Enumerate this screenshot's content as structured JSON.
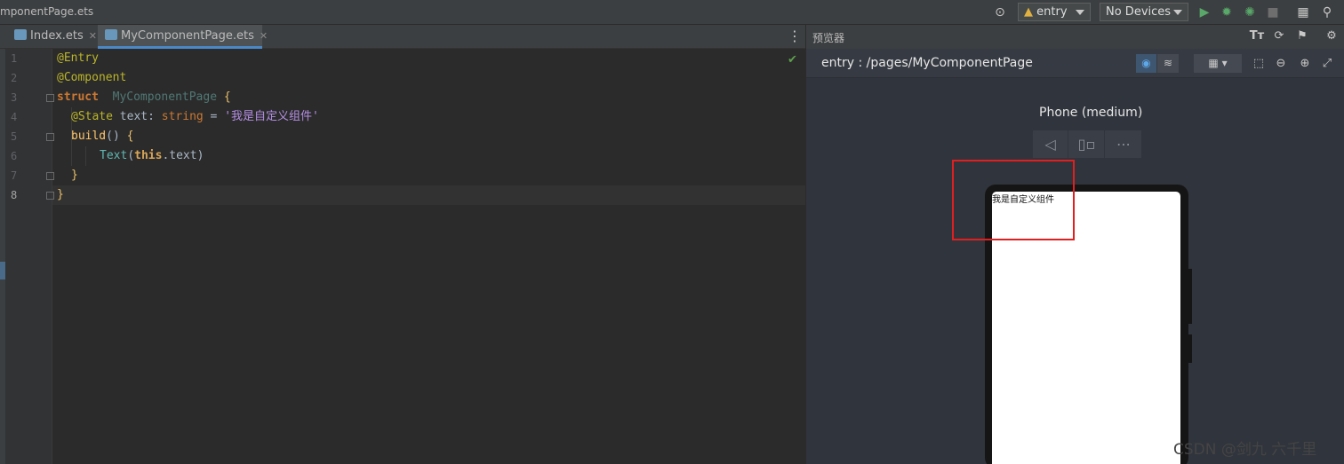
{
  "titlebar": {
    "file_title": "mponentPage.ets",
    "run_config": "entry",
    "device": "No Devices",
    "icons": [
      "target-icon",
      "module-icon",
      "run-icon",
      "debug-icon",
      "attach-debug-icon",
      "stop-icon",
      "project-structure-icon",
      "search-icon"
    ]
  },
  "editor": {
    "tabs": [
      {
        "label": "Index.ets",
        "active": false
      },
      {
        "label": "MyComponentPage.ets",
        "active": true
      }
    ],
    "line_numbers": [
      "1",
      "2",
      "3",
      "4",
      "5",
      "6",
      "7",
      "8"
    ],
    "code": {
      "l1": "@Entry",
      "l2": "@Component",
      "l3_kw": "struct",
      "l3_name": "MyComponentPage",
      "l3_brace": "{",
      "l4_ann": "@State",
      "l4_id": " text: ",
      "l4_type": "string",
      "l4_eq": " = ",
      "l4_str": "'我是自定义组件'",
      "l5_fn": "build",
      "l5_paren": "() ",
      "l5_brace": "{",
      "l6_call": "Text",
      "l6_open": "(",
      "l6_this": "this",
      "l6_rest": ".text)",
      "l7": "}",
      "l8": "}"
    }
  },
  "previewer": {
    "title": "预览器",
    "route": "entry : /pages/MyComponentPage",
    "device_label": "Phone (medium)",
    "screen_text": "我是自定义组件",
    "colors": {
      "highlight": "#e02020",
      "accent": "#4a88c7"
    }
  },
  "watermark": "CSDN @剑九 六千里"
}
